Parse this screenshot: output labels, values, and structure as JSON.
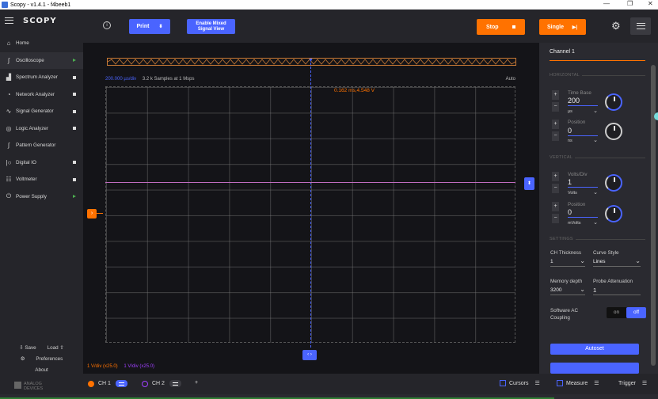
{
  "window": {
    "title": "Scopy - v1.4.1 - f4beeb1"
  },
  "sidebar": {
    "logo": "SCOPY",
    "items": [
      {
        "label": "Home",
        "icon": "home-icon",
        "status": ""
      },
      {
        "label": "Oscilloscope",
        "icon": "oscilloscope-icon",
        "status": "play"
      },
      {
        "label": "Spectrum Analyzer",
        "icon": "spectrum-icon",
        "status": "stop"
      },
      {
        "label": "Network Analyzer",
        "icon": "network-icon",
        "status": "stop"
      },
      {
        "label": "Signal Generator",
        "icon": "signal-icon",
        "status": "stop"
      },
      {
        "label": "Logic Analyzer",
        "icon": "logic-icon",
        "status": "stop"
      },
      {
        "label": "Pattern Generator",
        "icon": "pattern-icon",
        "status": ""
      },
      {
        "label": "Digital IO",
        "icon": "digital-io-icon",
        "status": "stop"
      },
      {
        "label": "Voltmeter",
        "icon": "voltmeter-icon",
        "status": "stop"
      },
      {
        "label": "Power Supply",
        "icon": "power-icon",
        "status": "play"
      }
    ],
    "save": "Save",
    "load": "Load",
    "preferences": "Preferences",
    "about": "About",
    "brand": "ANALOG DEVICES"
  },
  "toolbar": {
    "print": "Print",
    "mixed": "Enable Mixed Signal View",
    "stop": "Stop",
    "single": "Single"
  },
  "plot": {
    "timebase": "200.000 µs/div",
    "samples": "3.2 k Samples at 1 Msps",
    "auto": "Auto",
    "cursor_readout": "0.162 ms,4.548 V",
    "ch1_vdiv": "1 V/div (x25.0)",
    "ch2_vdiv": "1 V/div (x25.0)"
  },
  "panel": {
    "title": "Channel 1",
    "horizontal": "HORIZONTAL",
    "time_base_label": "Time Base",
    "time_base_value": "200",
    "time_base_unit": "µs",
    "hpos_label": "Position",
    "hpos_value": "0",
    "hpos_unit": "ns",
    "vertical": "VERTICAL",
    "volts_label": "Volts/Div",
    "volts_value": "1",
    "volts_unit": "Volts",
    "vpos_label": "Position",
    "vpos_value": "0",
    "vpos_unit": "mVolts",
    "settings": "SETTINGS",
    "thickness_label": "CH Thickness",
    "thickness_value": "1",
    "curve_label": "Curve Style",
    "curve_value": "Lines",
    "memory_label": "Memory depth",
    "memory_value": "3200",
    "probe_label": "Probe Attenuation",
    "probe_value": "1",
    "ac_label": "Software AC Coupling",
    "ac_on": "on",
    "ac_off": "off",
    "autoset": "Autoset"
  },
  "status": {
    "ch1": "CH 1",
    "ch2": "CH 2",
    "add": "+",
    "cursors": "Cursors",
    "measure": "Measure",
    "trigger": "Trigger"
  },
  "colors": {
    "accent": "#4a64ff",
    "orange": "#ff7200",
    "ch2": "#a040ff"
  }
}
